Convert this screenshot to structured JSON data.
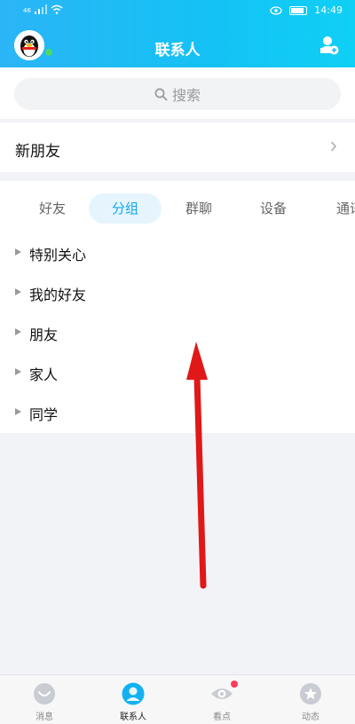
{
  "status_bar": {
    "signal_text": "46",
    "time": "14:49"
  },
  "header": {
    "title": "联系人"
  },
  "search": {
    "placeholder": "搜索"
  },
  "new_friends": {
    "label": "新朋友"
  },
  "tabs": [
    {
      "label": "好友",
      "active": false
    },
    {
      "label": "分组",
      "active": true
    },
    {
      "label": "群聊",
      "active": false
    },
    {
      "label": "设备",
      "active": false
    },
    {
      "label": "通讯",
      "active": false
    }
  ],
  "groups": [
    "特别关心",
    "我的好友",
    "朋友",
    "家人",
    "同学"
  ],
  "bottom_nav": [
    {
      "label": "消息",
      "icon": "message-icon",
      "active": false
    },
    {
      "label": "联系人",
      "icon": "contacts-icon",
      "active": true
    },
    {
      "label": "看点",
      "icon": "eye-icon",
      "active": false,
      "badge": true
    },
    {
      "label": "动态",
      "icon": "star-icon",
      "active": false
    }
  ],
  "colors": {
    "accent": "#12a7ef",
    "header_start": "#2bb5f7",
    "header_end": "#0fd0f5",
    "annotation_arrow": "#e01818"
  }
}
